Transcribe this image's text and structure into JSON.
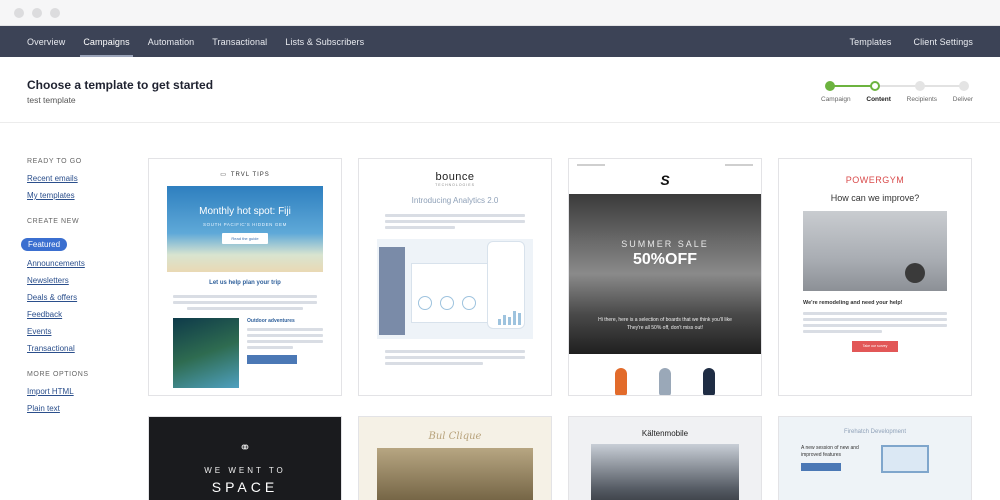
{
  "window": {
    "controls": [
      "close",
      "minimize",
      "zoom"
    ]
  },
  "nav": {
    "left": [
      "Overview",
      "Campaigns",
      "Automation",
      "Transactional",
      "Lists & Subscribers"
    ],
    "active": "Campaigns",
    "right": [
      "Templates",
      "Client Settings"
    ]
  },
  "header": {
    "title": "Choose a template to get started",
    "subtitle": "test template"
  },
  "progress": {
    "steps": [
      "Campaign",
      "Content",
      "Recipients",
      "Deliver"
    ],
    "current": "Content",
    "accent": "#6cb33f"
  },
  "sidebar": {
    "ready": {
      "heading": "READY TO GO",
      "links": [
        "Recent emails",
        "My templates"
      ]
    },
    "create": {
      "heading": "CREATE NEW",
      "selected": "Featured",
      "links": [
        "Announcements",
        "Newsletters",
        "Deals & offers",
        "Feedback",
        "Events",
        "Transactional"
      ]
    },
    "more": {
      "heading": "MORE OPTIONS",
      "links": [
        "Import HTML",
        "Plain text"
      ]
    },
    "link_color": "#2b4f8c",
    "pill_color": "#3b6fd0"
  },
  "templates": {
    "c1": {
      "logo": "TRVL TIPS",
      "hero_title": "Monthly hot spot: Fiji",
      "hero_sub": "SOUTH PACIFIC'S HIDDEN GEM",
      "hero_button": "Read the guide",
      "section": "Let us help plan your trip",
      "sub_section": "Outdoor adventures"
    },
    "c2": {
      "logo": "bounce",
      "logo_sub": "TECHNOLOGIES",
      "title": "Introducing Analytics 2.0"
    },
    "c3": {
      "logo": "S",
      "line1": "SUMMER SALE",
      "line2": "50%OFF",
      "line3": "Hi there, here is a selection of boards that we think you'll like",
      "line4": "They're all 50% off, don't miss out!"
    },
    "c4": {
      "logo": "POWERGYM",
      "title": "How can we improve?",
      "sub": "We're remodeling and need your help!",
      "button": "Take our survey"
    },
    "c5": {
      "line1": "WE WENT TO",
      "line2": "SPACE"
    },
    "c6": {
      "logo": "Bul Clique"
    },
    "c7": {
      "logo": "Kältenmobile"
    },
    "c8": {
      "logo": "Firehatch Development",
      "text": "A new session of new and improved features"
    }
  }
}
